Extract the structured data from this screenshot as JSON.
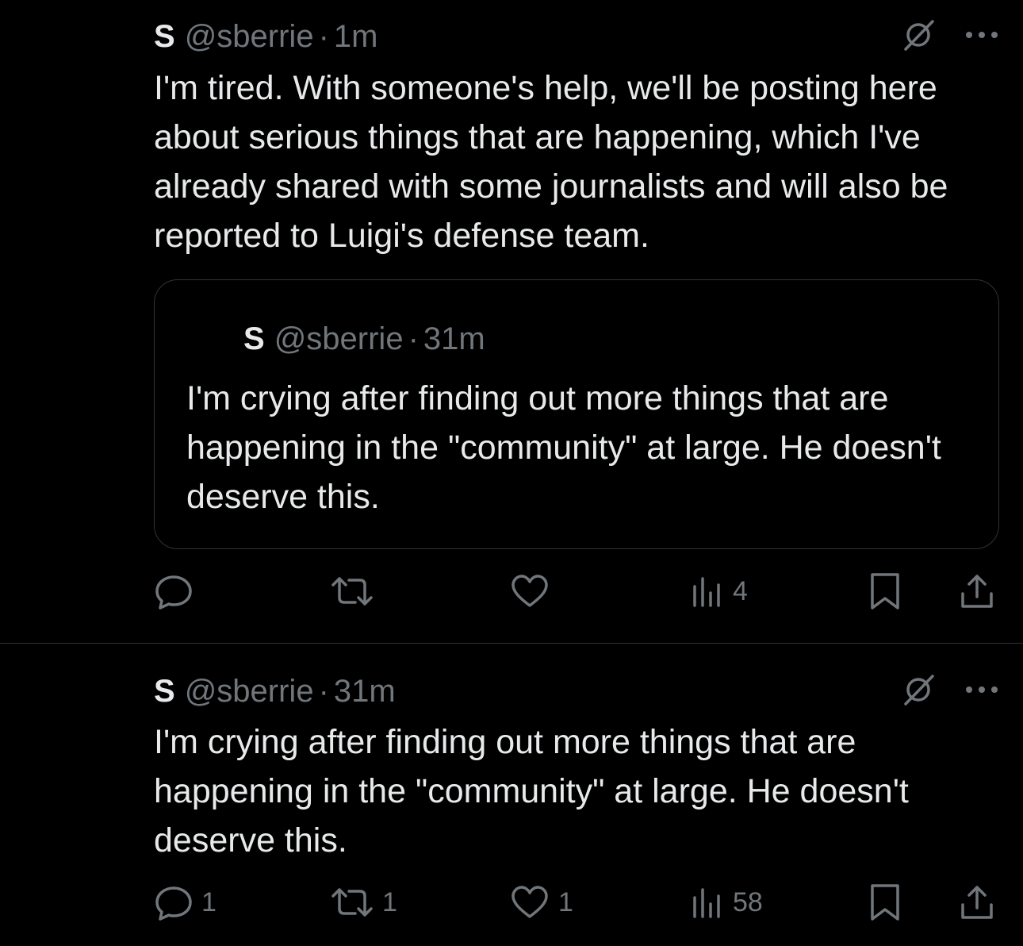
{
  "posts": [
    {
      "display_name": "S",
      "handle": "@sberrie",
      "separator": "·",
      "time": "1m",
      "text": "I'm tired. With someone's help, we'll be posting here about serious things that are happening, which I've already shared with some journalists and will also be reported to Luigi's defense team.",
      "quote": {
        "display_name": "S",
        "handle": "@sberrie",
        "separator": "·",
        "time": "31m",
        "text": "I'm crying after finding out more things that are happening in the \"community\" at large. He doesn't deserve this."
      },
      "actions": {
        "reply_count": "",
        "repost_count": "",
        "like_count": "",
        "views_count": "4"
      }
    },
    {
      "display_name": "S",
      "handle": "@sberrie",
      "separator": "·",
      "time": "31m",
      "text": "I'm crying after finding out more things that are happening in the \"community\" at large. He doesn't deserve this.",
      "actions": {
        "reply_count": "1",
        "repost_count": "1",
        "like_count": "1",
        "views_count": "58"
      }
    }
  ],
  "icons": {
    "grok": "grok-icon",
    "more": "more-icon",
    "reply": "reply-icon",
    "repost": "repost-icon",
    "like": "like-icon",
    "views": "views-icon",
    "bookmark": "bookmark-icon",
    "share": "share-icon"
  },
  "colors": {
    "background": "#000000",
    "primary_text": "#e7e9ea",
    "secondary_text": "#71767b",
    "border": "#2f3336"
  }
}
